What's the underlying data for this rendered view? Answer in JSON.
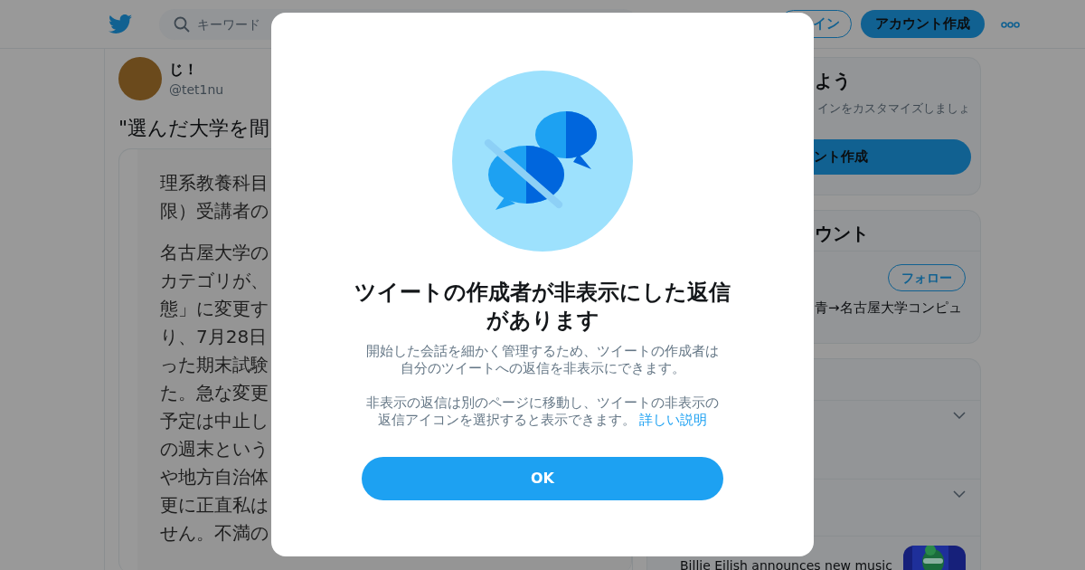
{
  "header": {
    "search": {
      "placeholder": "キーワード"
    },
    "login_button": "イン",
    "signup_button": "アカウント作成"
  },
  "tweet": {
    "author_name": "じ！",
    "handle": "@tet1nu",
    "text": "\"選んだ大学を間",
    "quoted_paragraphs": [
      [
        "理系教養科目",
        "限）受講者の"
      ],
      [
        "名古屋大学の",
        "カテゴリが、",
        "態」に変更す",
        "り、7月28日",
        "った期末試験",
        "た。急な変更",
        "予定は中止し",
        "の週末という",
        "や地方自治体",
        "更に正直私は",
        "せん。不満の"
      ]
    ]
  },
  "sidebar": {
    "signup_card": {
      "title": "よう",
      "description": "インをカスタマイズしましょ",
      "button": "ント作成"
    },
    "accounts_card": {
      "title": "ウント",
      "follow_button": "フォロー",
      "bio": "青→名古屋大学コンピュ"
    },
    "trends_card": {
      "news_headline": "Billie Eilish announces new music"
    }
  },
  "dialog": {
    "title": "ツイートの作成者が非表示にした返信があります",
    "paragraphs": [
      "開始した会話を細かく管理するため、ツイートの作成者は自分のツイートへの返信を非表示にできます。",
      "非表示の返信は別のページに移動し、ツイートの非表示の返信アイコンを選択すると表示できます。"
    ],
    "link": "詳しい説明",
    "ok_button": "OK"
  }
}
